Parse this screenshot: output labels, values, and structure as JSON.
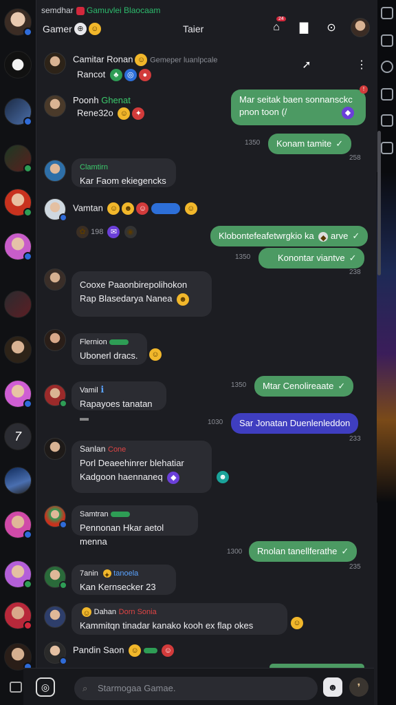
{
  "status_bar": {
    "left_text": "semdhar",
    "mid_text": "Gamuvlei Blaocaam"
  },
  "header": {
    "title": "Gamer",
    "center_title": "Taier",
    "notif_badge": "24"
  },
  "rail_icons": [
    "user-avatar",
    "ghost",
    "bird",
    "green",
    "red",
    "pink",
    "dark",
    "elf",
    "pink2",
    "logo",
    "planet",
    "red2",
    "pink3",
    "teal",
    "red4",
    "dark5"
  ],
  "messages": {
    "m1": {
      "name": "Camitar Ronan",
      "note": "Gemeper luanlpcale",
      "sub": "Rancot"
    },
    "m2": {
      "name": "Poonh",
      "green_label": "Ghenat",
      "text": "Rene32o"
    },
    "m3": {
      "text_line1": "Mar seitak baen sonnansckc",
      "text_line2": "pnon toon (/",
      "time": "1350"
    },
    "m4": {
      "text": "Konam tamite",
      "time": "258"
    },
    "m5": {
      "name": "Clamtirn",
      "text": "Kar Faom ekiegencks"
    },
    "m6": {
      "name": "Vamtan",
      "sub": "198"
    },
    "m7": {
      "text": "Klobontefeafetwrgkio ka",
      "tail": "arve"
    },
    "m8": {
      "text": "Konontar viantve",
      "time": "1350",
      "time2": "238"
    },
    "m9": {
      "line1": "Cooxe Paaonbirepolihokon",
      "line2": "Rap Blasedarya Nanea"
    },
    "m10": {
      "name": "Flernion",
      "text": "Ubonerl dracs."
    },
    "m11": {
      "name": "Vamil",
      "text": "Rapayoes tanatan"
    },
    "m12": {
      "text": "Mtar Cenolireaate",
      "time": "1350"
    },
    "m13": {
      "text": "Sar Jonatan Duenlenleddon",
      "time": "1030",
      "time2": "233"
    },
    "m14": {
      "name": "Sanlan",
      "red_label": "Cone",
      "line1": "Porl Deaeehinrer blehatiar",
      "line2": "Kadgoon haennaneq"
    },
    "m15": {
      "name": "Samtran",
      "text": "Pennonan Hkar aetol menna"
    },
    "m16": {
      "text": "Rnolan tanellferathe",
      "time": "1300",
      "time2": "235"
    },
    "m17": {
      "name": "7anin",
      "blue_label": "tanoela",
      "text": "Kan Kernsecker 23"
    },
    "m18": {
      "name": "Dahan",
      "red_label": "Dorn Sonia",
      "text": "Kammitqn tinadar kanako kooh ex flap okes"
    },
    "m19": {
      "name": "Pandin Saon"
    }
  },
  "composer": {
    "placeholder": "Starmogaa Gamae."
  }
}
